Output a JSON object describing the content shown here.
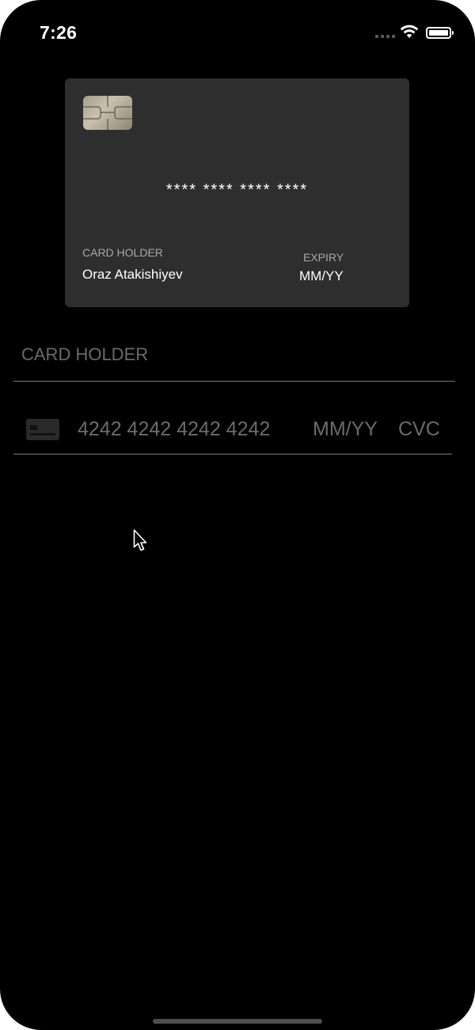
{
  "status_bar": {
    "time": "7:26",
    "signal_icon": "cellular-signal-icon",
    "wifi_icon": "wifi-icon",
    "battery_icon": "battery-icon"
  },
  "card_preview": {
    "chip_icon": "card-chip-icon",
    "number_masked": "**** **** **** ****",
    "holder_label": "CARD HOLDER",
    "holder_name": "Oraz Atakishiyev",
    "expiry_label": "EXPIRY",
    "expiry_value": "MM/YY",
    "background_color": "#2f2e2f"
  },
  "form": {
    "holder_placeholder": "CARD HOLDER",
    "card_icon": "credit-card-icon",
    "number_placeholder": "4242 4242 4242 4242",
    "expiry_placeholder": "MM/YY",
    "cvc_placeholder": "CVC"
  },
  "colors": {
    "background": "#000000",
    "placeholder": "#6b6b6b",
    "divider": "#7a7a7a"
  }
}
